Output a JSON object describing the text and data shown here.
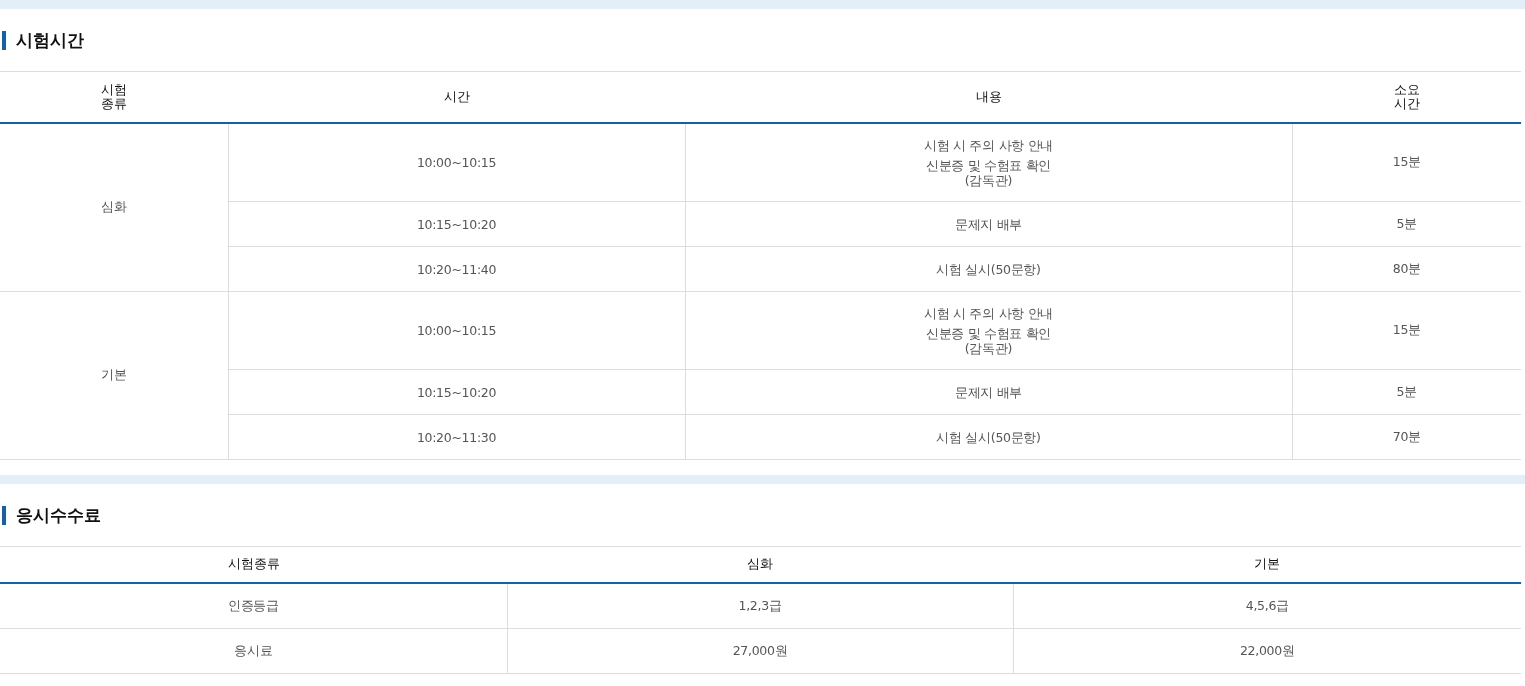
{
  "schedule": {
    "title": "시험시간",
    "columns": [
      "시험\n종류",
      "시간",
      "내용",
      "소요\n시간"
    ],
    "groups": [
      {
        "type": "심화",
        "rows": [
          {
            "time": "10:00~10:15",
            "content": [
              "시험 시 주의 사항 안내",
              "신분증 및 수험표 확인\n(감독관)"
            ],
            "duration": "15분"
          },
          {
            "time": "10:15~10:20",
            "content": [
              "문제지 배부"
            ],
            "duration": "5분"
          },
          {
            "time": "10:20~11:40",
            "content": [
              "시험 실시(50문항)"
            ],
            "duration": "80분"
          }
        ]
      },
      {
        "type": "기본",
        "rows": [
          {
            "time": "10:00~10:15",
            "content": [
              "시험 시 주의 사항 안내",
              "신분증 및 수험표 확인\n(감독관)"
            ],
            "duration": "15분"
          },
          {
            "time": "10:15~10:20",
            "content": [
              "문제지 배부"
            ],
            "duration": "5분"
          },
          {
            "time": "10:20~11:30",
            "content": [
              "시험 실시(50문항)"
            ],
            "duration": "70분"
          }
        ]
      }
    ]
  },
  "fees": {
    "title": "응시수수료",
    "columns": [
      "시험종류",
      "심화",
      "기본"
    ],
    "rows": [
      [
        "인증등급",
        "1,2,3급",
        "4,5,6급"
      ],
      [
        "응시료",
        "27,000원",
        "22,000원"
      ]
    ]
  }
}
